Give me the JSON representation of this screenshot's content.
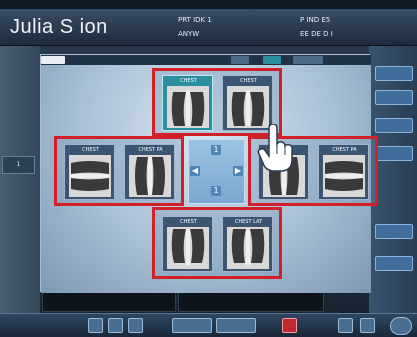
{
  "header": {
    "app_title": "Julia S  ion",
    "info_left": "PRT  IDK   1",
    "info_left_sub": "ANYW",
    "info_right": "P  IND   E5",
    "info_right_sub": "EE DE  D  I"
  },
  "leftcol": {
    "marker": "1"
  },
  "groups": {
    "top": {
      "thumbs": [
        {
          "label": "CHEST",
          "active": true
        },
        {
          "label": "CHEST",
          "active": false
        }
      ]
    },
    "left": {
      "thumbs": [
        {
          "label": "CHEST",
          "active": false
        },
        {
          "label": "CHEST PA",
          "active": false
        }
      ]
    },
    "right": {
      "thumbs": [
        {
          "label": "CHEST",
          "active": false
        },
        {
          "label": "CHEST PA",
          "active": false
        }
      ]
    },
    "bottom": {
      "thumbs": [
        {
          "label": "CHEST",
          "active": false
        },
        {
          "label": "CHEST LAT",
          "active": false
        }
      ]
    }
  },
  "center_arrows": {
    "up": "1",
    "down": "1",
    "left": "◀",
    "right": "▶"
  },
  "colors": {
    "highlight": "#d0202a",
    "accent": "#2c8fa0"
  },
  "icons": [
    "hand-pointer-icon",
    "arrow-up-icon",
    "arrow-down-icon",
    "arrow-left-icon",
    "arrow-right-icon"
  ]
}
